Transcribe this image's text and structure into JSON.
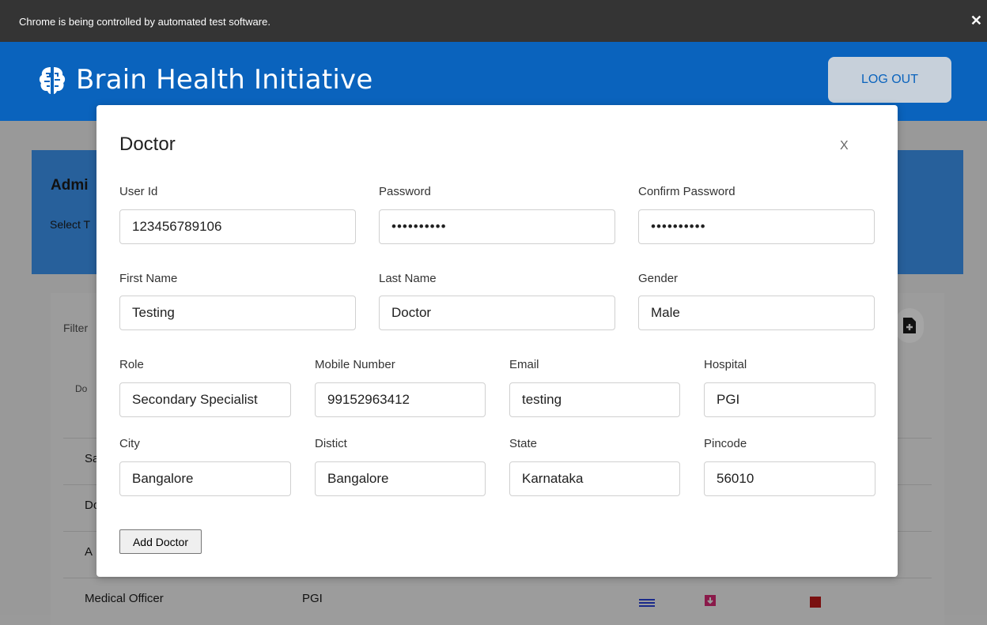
{
  "automation_bar": {
    "message": "Chrome is being controlled by automated test software.",
    "close_label": "✕"
  },
  "header": {
    "brand_title": "Brain Health Initiative",
    "brand_icon": "brain-icon",
    "logout_label": "LOG OUT",
    "accent_color": "#0a63bd"
  },
  "admin_panel": {
    "heading": "Admi",
    "sub": "Select T"
  },
  "table": {
    "filter_label": "Filter",
    "header_partial": "Do",
    "rows_partial": [
      "Sa",
      "Do",
      "A"
    ],
    "last_row": {
      "role": "Medical Officer",
      "hospital": "PGI"
    }
  },
  "modal": {
    "title": "Doctor",
    "close_label": "X",
    "fields": {
      "user_id": {
        "label": "User Id",
        "value": "123456789106"
      },
      "password": {
        "label": "Password",
        "value": "••••••••••"
      },
      "confirm_password": {
        "label": "Confirm Password",
        "value": "••••••••••"
      },
      "first_name": {
        "label": "First Name",
        "value": "Testing"
      },
      "last_name": {
        "label": "Last Name",
        "value": "Doctor"
      },
      "gender": {
        "label": "Gender",
        "value": "Male"
      },
      "role": {
        "label": "Role",
        "value": "Secondary Specialist"
      },
      "mobile": {
        "label": "Mobile Number",
        "value": "99152963412"
      },
      "email": {
        "label": "Email",
        "value": "testing"
      },
      "hospital": {
        "label": "Hospital",
        "value": "PGI"
      },
      "city": {
        "label": "City",
        "value": "Bangalore"
      },
      "district": {
        "label": "Distict",
        "value": "Bangalore"
      },
      "state": {
        "label": "State",
        "value": "Karnataka"
      },
      "pincode": {
        "label": "Pincode",
        "value": "56010"
      }
    },
    "submit_label": "Add Doctor"
  }
}
